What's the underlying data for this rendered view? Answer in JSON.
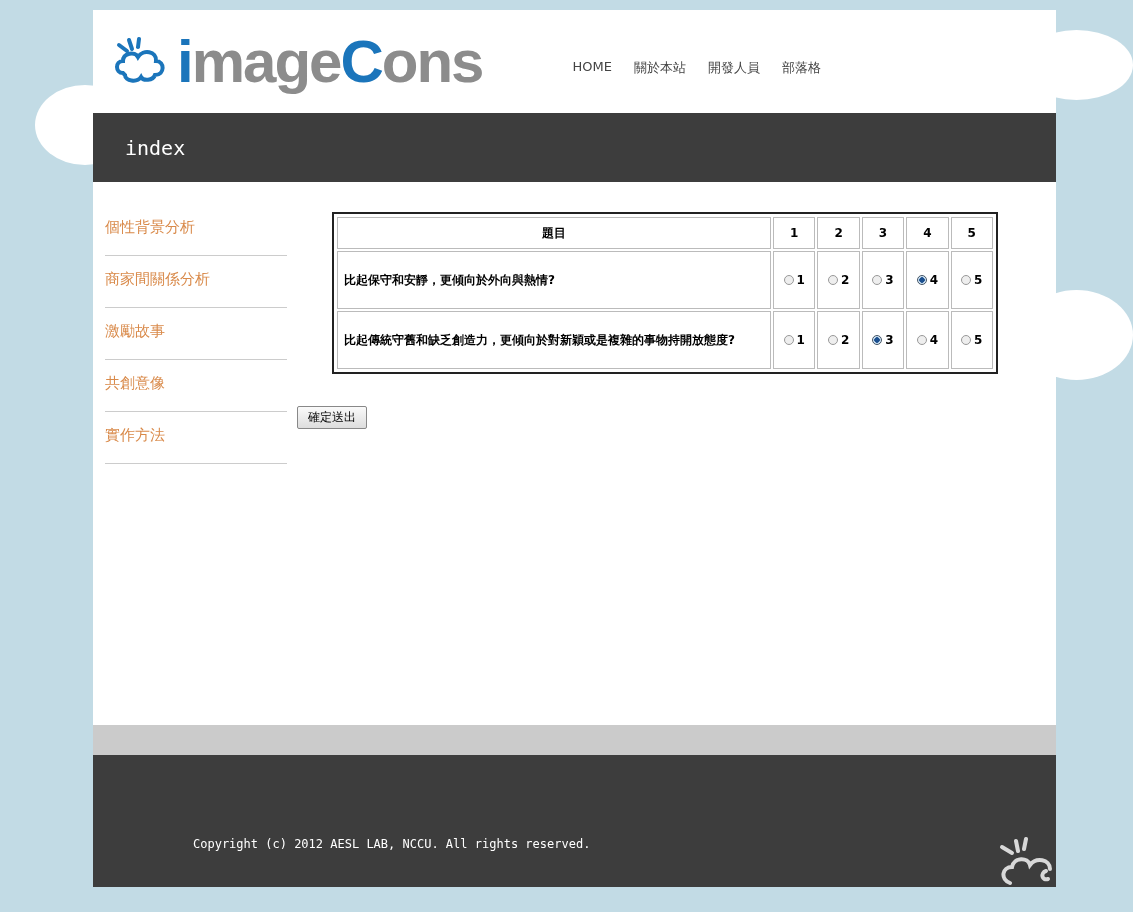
{
  "logo": {
    "parts": [
      {
        "text": "i",
        "accent": true
      },
      {
        "text": "mage",
        "accent": false
      },
      {
        "text": "C",
        "accent": true
      },
      {
        "text": "ons",
        "accent": false
      }
    ]
  },
  "nav": [
    {
      "label": "HOME"
    },
    {
      "label": "關於本站"
    },
    {
      "label": "開發人員"
    },
    {
      "label": "部落格"
    }
  ],
  "page_title": "index",
  "sidebar": {
    "items": [
      {
        "label": "個性背景分析"
      },
      {
        "label": "商家間關係分析"
      },
      {
        "label": "激勵故事"
      },
      {
        "label": "共創意像"
      },
      {
        "label": "實作方法"
      }
    ]
  },
  "table": {
    "columns": [
      "題目",
      "1",
      "2",
      "3",
      "4",
      "5"
    ],
    "rows": [
      {
        "question": "比起保守和安靜，更傾向於外向與熱情?",
        "options": [
          {
            "label": "1",
            "selected": false
          },
          {
            "label": "2",
            "selected": false
          },
          {
            "label": "3",
            "selected": false
          },
          {
            "label": "4",
            "selected": true
          },
          {
            "label": "5",
            "selected": false
          }
        ]
      },
      {
        "question": "比起傳統守舊和缺乏創造力，更傾向於對新穎或是複雜的事物持開放態度?",
        "options": [
          {
            "label": "1",
            "selected": false
          },
          {
            "label": "2",
            "selected": false
          },
          {
            "label": "3",
            "selected": true
          },
          {
            "label": "4",
            "selected": false
          },
          {
            "label": "5",
            "selected": false
          }
        ]
      }
    ]
  },
  "submit_button": "確定送出",
  "footer": {
    "copyright": "Copyright (c) 2012 AESL LAB, NCCU. All rights reserved."
  }
}
